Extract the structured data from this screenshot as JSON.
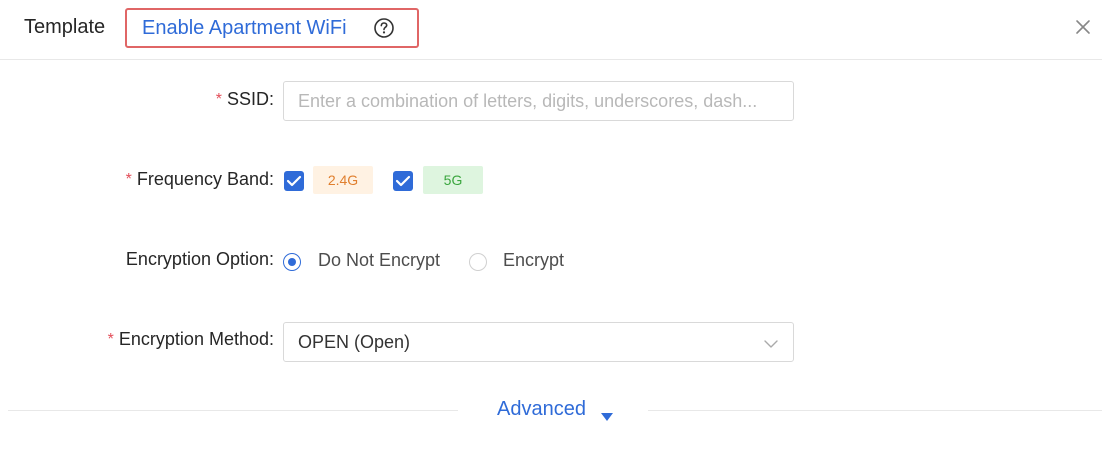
{
  "header": {
    "template_label": "Template",
    "title": "Enable Apartment WiFi",
    "help_icon": "question-circle-icon",
    "close_icon": "close-icon"
  },
  "form": {
    "ssid": {
      "required_mark": "*",
      "label": "SSID:",
      "value": "",
      "placeholder": "Enter a combination of letters, digits, underscores, dash..."
    },
    "frequency_band": {
      "required_mark": "*",
      "label": "Frequency Band:",
      "options": [
        {
          "label": "2.4G",
          "checked": true,
          "color": "#e07f2e"
        },
        {
          "label": "5G",
          "checked": true,
          "color": "#3aa63e"
        }
      ]
    },
    "encryption_option": {
      "label": "Encryption Option:",
      "options": [
        {
          "label": "Do Not Encrypt",
          "selected": true
        },
        {
          "label": "Encrypt",
          "selected": false
        }
      ]
    },
    "encryption_method": {
      "required_mark": "*",
      "label": "Encryption Method:",
      "value": "OPEN (Open)",
      "arrow_icon": "chevron-down-icon"
    }
  },
  "advanced": {
    "label": "Advanced",
    "icon": "caret-down-icon"
  },
  "colors": {
    "accent": "#2f6bd8",
    "required": "#e34d59",
    "highlight_border": "#e06666"
  }
}
